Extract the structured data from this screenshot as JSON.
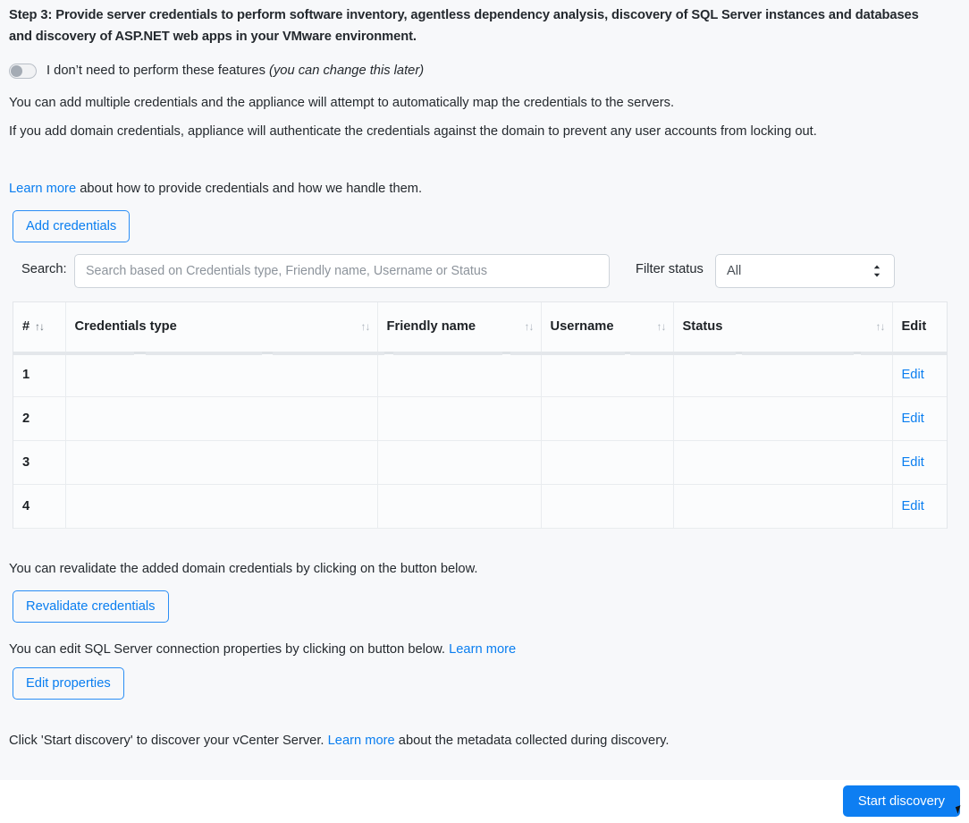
{
  "step": {
    "title": "Step 3: Provide server credentials to perform software inventory, agentless dependency analysis, discovery of SQL Server instances and databases and discovery of ASP.NET web apps in your VMware environment."
  },
  "toggle": {
    "label": "I don’t need to perform these features",
    "hint": "(you can change this later)",
    "state": "off"
  },
  "paragraphs": {
    "multiple_credentials": "You can add multiple credentials and the appliance will attempt to automatically map the credentials to the servers.",
    "domain_credentials": "If you add domain credentials, appliance will authenticate the credentials against  the domain to prevent any user accounts from locking out.",
    "learn_more_label": "Learn more",
    "learn_more_tail": " about how to provide credentials and how we handle them.",
    "revalidate_text": "You can revalidate the added domain credentials by clicking on the button below.",
    "sql_props_text": "You can edit SQL Server connection properties by clicking on button below. ",
    "sql_props_link": "Learn more",
    "click_lead": "Click 'Start discovery' to discover your vCenter Server. ",
    "click_link": "Learn more",
    "click_tail": " about the metadata collected during discovery."
  },
  "buttons": {
    "add_credentials": "Add credentials",
    "revalidate_credentials": "Revalidate credentials",
    "edit_properties": "Edit properties",
    "start_discovery": "Start discovery"
  },
  "search": {
    "label": "Search:",
    "value": "",
    "placeholder": "Search based on Credentials type, Friendly name, Username or Status"
  },
  "filter": {
    "label": "Filter status",
    "selected": "All",
    "options": [
      "All"
    ]
  },
  "table": {
    "columns": [
      {
        "key": "num",
        "label": "#",
        "sortable": true
      },
      {
        "key": "type",
        "label": "Credentials type",
        "sortable": true
      },
      {
        "key": "friendly",
        "label": "Friendly name",
        "sortable": true
      },
      {
        "key": "username",
        "label": "Username",
        "sortable": true
      },
      {
        "key": "status",
        "label": "Status",
        "sortable": true
      },
      {
        "key": "edit",
        "label": "Edit",
        "sortable": false
      }
    ],
    "sort_icon": "↑↓",
    "edit_label": "Edit",
    "rows": [
      {
        "num": "1",
        "type": "",
        "friendly": "",
        "username": "",
        "status": ""
      },
      {
        "num": "2",
        "type": "",
        "friendly": "",
        "username": "",
        "status": ""
      },
      {
        "num": "3",
        "type": "",
        "friendly": "",
        "username": "",
        "status": ""
      },
      {
        "num": "4",
        "type": "",
        "friendly": "",
        "username": "",
        "status": ""
      }
    ]
  },
  "colors": {
    "accent": "#0d7ef2",
    "link": "#0a7ef0",
    "page_bg": "#f7f8fa",
    "text": "#24292e",
    "border": "#e3e6ea"
  }
}
